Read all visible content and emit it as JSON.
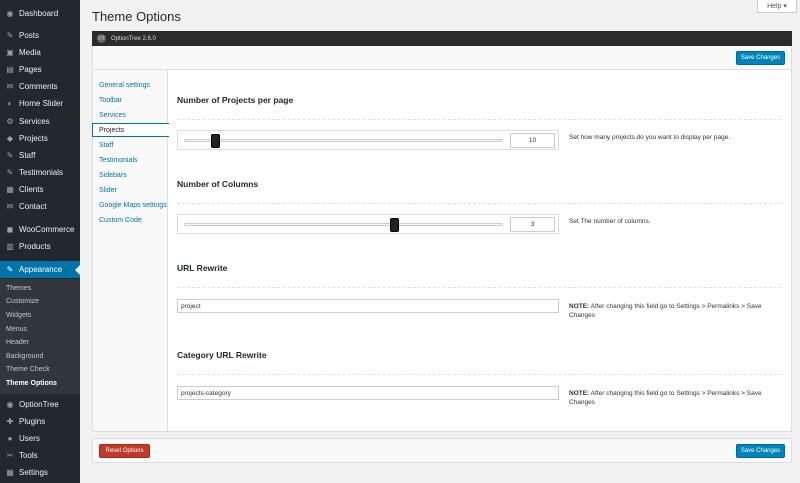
{
  "sidebar": {
    "items": [
      {
        "label": "Dashboard",
        "icon": "◉"
      },
      {
        "label": "Posts",
        "icon": "✎"
      },
      {
        "label": "Media",
        "icon": "▣"
      },
      {
        "label": "Pages",
        "icon": "▤"
      },
      {
        "label": "Comments",
        "icon": "✉"
      },
      {
        "label": "Home Slider",
        "icon": "◐"
      },
      {
        "label": "Services",
        "icon": "⚙"
      },
      {
        "label": "Projects",
        "icon": "◆"
      },
      {
        "label": "Staff",
        "icon": "✎"
      },
      {
        "label": "Testimonials",
        "icon": "✎"
      },
      {
        "label": "Clients",
        "icon": "▦"
      },
      {
        "label": "Contact",
        "icon": "✉"
      },
      {
        "label": "WooCommerce",
        "icon": "◼"
      },
      {
        "label": "Products",
        "icon": "▥"
      },
      {
        "label": "Appearance",
        "icon": "✎"
      },
      {
        "label": "OptionTree",
        "icon": "◉"
      },
      {
        "label": "Plugins",
        "icon": "✚"
      },
      {
        "label": "Users",
        "icon": "●"
      },
      {
        "label": "Tools",
        "icon": "✂"
      },
      {
        "label": "Settings",
        "icon": "▦"
      }
    ],
    "submenu": [
      "Themes",
      "Customize",
      "Widgets",
      "Menus",
      "Header",
      "Background",
      "Theme Check",
      "Theme Options"
    ]
  },
  "header": {
    "title": "Theme Options",
    "help": "Help ▾"
  },
  "optiontree": {
    "logo": "OT",
    "version": "OptionTree 2.6.0",
    "save_label": "Save Changes",
    "reset_label": "Reset Options"
  },
  "tabs": [
    "General settings",
    "Toolbar",
    "Services",
    "Projects",
    "Staff",
    "Testimonials",
    "Sidebars",
    "Slider",
    "Google Maps settings",
    "Custom Code"
  ],
  "fields": {
    "projects_per_page": {
      "title": "Number of Projects per page",
      "value": "10",
      "slider_fraction": 0.1,
      "desc": "Set how many projects do you want to display per page."
    },
    "columns": {
      "title": "Number of Columns",
      "value": "3",
      "slider_fraction": 0.66,
      "desc": "Set The number of columns."
    },
    "url_rewrite": {
      "title": "URL Rewrite",
      "value": "project",
      "note_label": "NOTE:",
      "note": " After changing this field go to Settings > Permalinks > Save Changes"
    },
    "category_rewrite": {
      "title": "Category URL Rewrite",
      "value": "projects-category",
      "note_label": "NOTE:",
      "note": " After changing this field go to Settings > Permalinks > Save Changes"
    }
  },
  "colors": {
    "accent": "#0073aa",
    "primary_button": "#0085ba",
    "danger_button": "#c0392b",
    "sidebar_bg": "#23282d"
  }
}
